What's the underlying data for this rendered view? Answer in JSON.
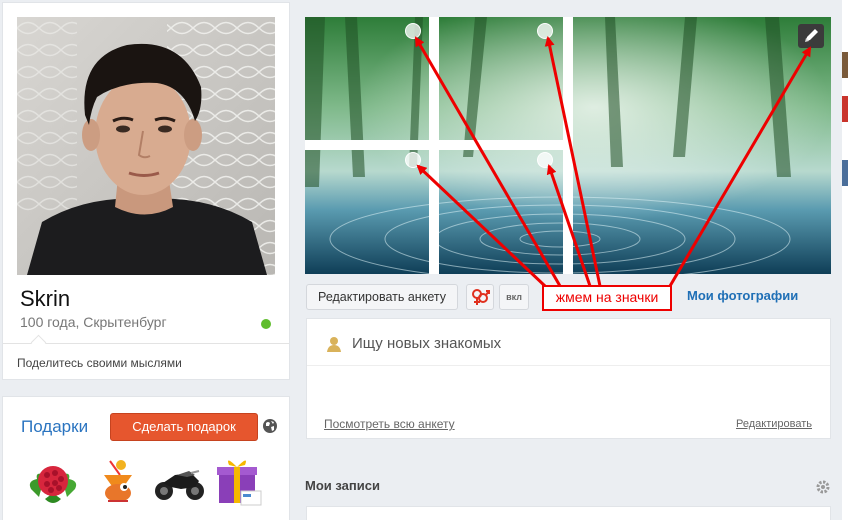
{
  "profile": {
    "name": "Skrin",
    "meta": "100 года, Скрытенбург",
    "status_prompt": "Поделитесь своими мыслями",
    "online_color": "#5fbd2c"
  },
  "gifts": {
    "title": "Подарки",
    "button_label": "Сделать подарок",
    "icon": "globe-icon",
    "items": [
      "raspberry-gift",
      "bird-cocktail-gift",
      "motorcycle-gift",
      "gift-box-gift"
    ]
  },
  "banner": {
    "edit_icon": "pencil-icon"
  },
  "toolbar": {
    "edit_profile_label": "Редактировать анкету",
    "gender_icon": "gender-icon",
    "toggle_label": "вкл",
    "my_photos_label": "Мои фотографии"
  },
  "annotation": {
    "text": "жмем на значки",
    "color": "#ee0000"
  },
  "about": {
    "looking_text": "Ищу новых знакомых",
    "view_profile_link": "Посмотреть всю анкету",
    "edit_link": "Редактировать"
  },
  "posts": {
    "title": "Мои записи",
    "settings_icon": "gear-icon"
  },
  "colors": {
    "link": "#1f6fb6",
    "accent_button": "#e6562e",
    "page_bg": "#ebeef2"
  }
}
